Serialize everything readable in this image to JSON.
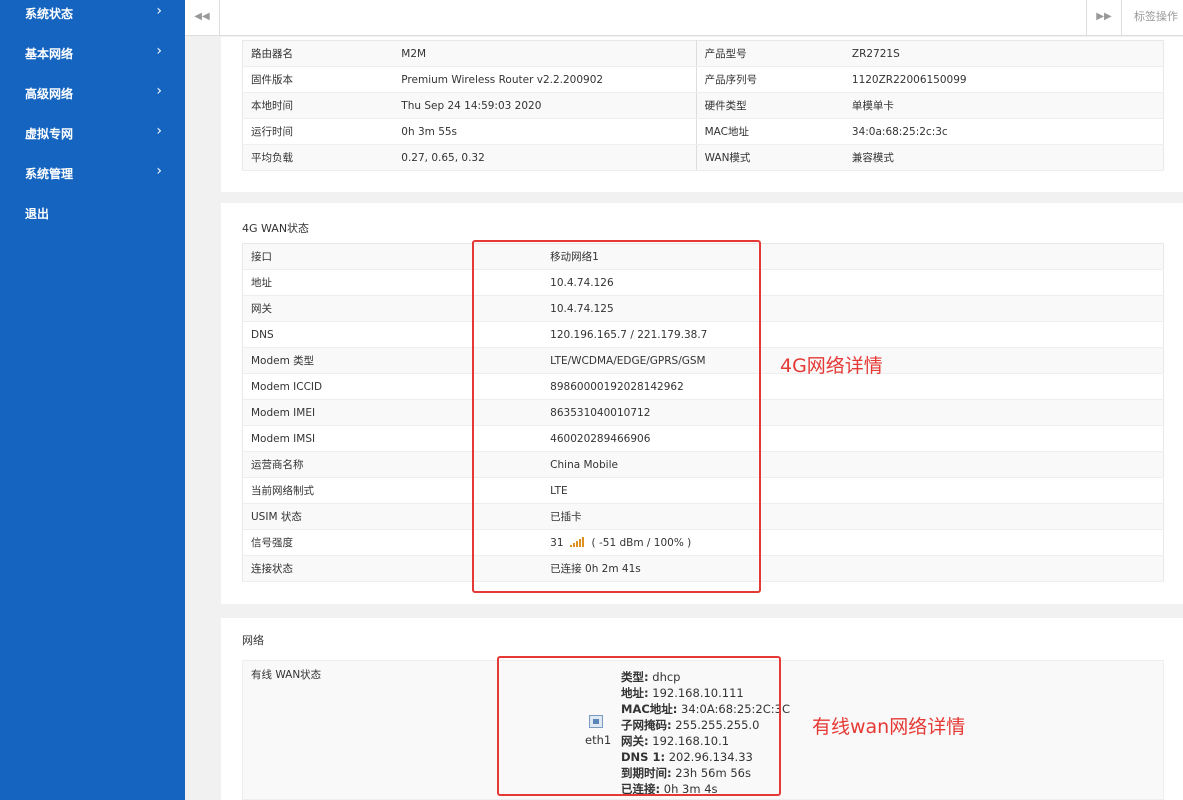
{
  "sidebar": {
    "items": [
      {
        "label": "系统状态"
      },
      {
        "label": "基本网络"
      },
      {
        "label": "高级网络"
      },
      {
        "label": "虚拟专网"
      },
      {
        "label": "系统管理"
      },
      {
        "label": "退出"
      }
    ]
  },
  "topbar": {
    "tab_op_label": "标签操作"
  },
  "system": {
    "rows": [
      {
        "k1": "路由器名",
        "v1": "M2M",
        "k2": "产品型号",
        "v2": "ZR2721S"
      },
      {
        "k1": "固件版本",
        "v1": "Premium Wireless Router v2.2.200902",
        "k2": "产品序列号",
        "v2": "1120ZR22006150099"
      },
      {
        "k1": "本地时间",
        "v1": "Thu Sep 24 14:59:03 2020",
        "k2": "硬件类型",
        "v2": "单模单卡"
      },
      {
        "k1": "运行时间",
        "v1": "0h 3m 55s",
        "k2": "MAC地址",
        "v2": "34:0a:68:25:2c:3c"
      },
      {
        "k1": "平均负载",
        "v1": "0.27, 0.65, 0.32",
        "k2": "WAN模式",
        "v2": "兼容模式"
      }
    ]
  },
  "wan4g": {
    "title": "4G WAN状态",
    "rows": [
      {
        "k": "接口",
        "v": "移动网络1"
      },
      {
        "k": "地址",
        "v": "10.4.74.126"
      },
      {
        "k": "网关",
        "v": "10.4.74.125"
      },
      {
        "k": "DNS",
        "v": "120.196.165.7 / 221.179.38.7"
      },
      {
        "k": "Modem 类型",
        "v": "LTE/WCDMA/EDGE/GPRS/GSM"
      },
      {
        "k": "Modem ICCID",
        "v": "89860000192028142962"
      },
      {
        "k": "Modem IMEI",
        "v": "863531040010712"
      },
      {
        "k": "Modem IMSI",
        "v": "460020289466906"
      },
      {
        "k": "运营商名称",
        "v": "China Mobile"
      },
      {
        "k": "当前网络制式",
        "v": "LTE"
      },
      {
        "k": "USIM 状态",
        "v": "已插卡"
      },
      {
        "k": "信号强度",
        "v": "31"
      },
      {
        "k": "连接状态",
        "v": "已连接 0h 2m 41s"
      }
    ],
    "signal_detail": "( -51 dBm / 100% )",
    "signal_level": 1.0,
    "annotation": "4G网络详情"
  },
  "network": {
    "title": "网络",
    "wired_label": "有线 WAN状态",
    "iface": "eth1",
    "details": [
      {
        "k": "类型:",
        "v": " dhcp"
      },
      {
        "k": "地址:",
        "v": " 192.168.10.111"
      },
      {
        "k": "MAC地址:",
        "v": " 34:0A:68:25:2C:3C"
      },
      {
        "k": "子网掩码:",
        "v": " 255.255.255.0"
      },
      {
        "k": "网关:",
        "v": " 192.168.10.1"
      },
      {
        "k": "DNS 1:",
        "v": " 202.96.134.33"
      },
      {
        "k": "到期时间:",
        "v": " 23h 56m 56s"
      },
      {
        "k": "已连接:",
        "v": " 0h 3m 4s"
      }
    ],
    "annotation": "有线wan网络详情"
  },
  "colors": {
    "sidebar_bg": "#1565c0",
    "annotation_red": "#e53935"
  }
}
